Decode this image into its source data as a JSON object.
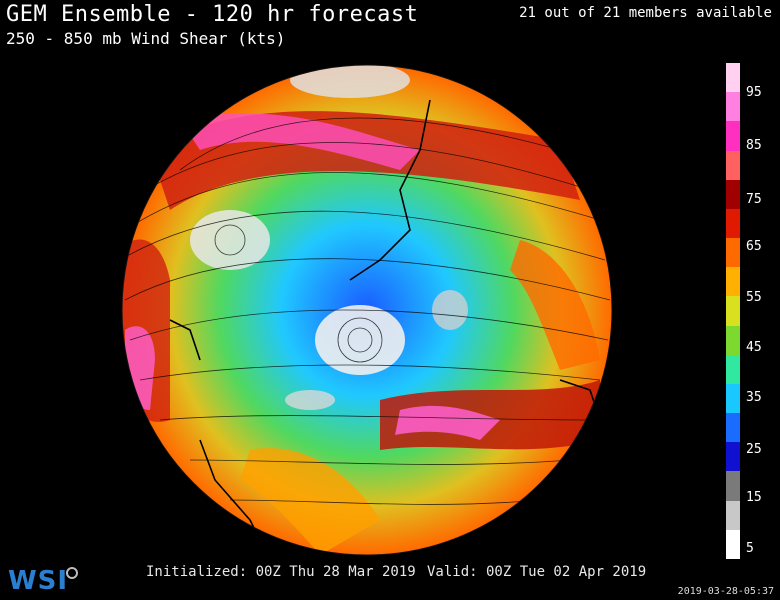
{
  "header": {
    "title": "GEM Ensemble - 120 hr forecast",
    "subtitle": "250 - 850 mb Wind Shear (kts)",
    "members": "21 out of 21 members available"
  },
  "legend": {
    "ticks": [
      "95",
      "85",
      "75",
      "65",
      "55",
      "45",
      "35",
      "25",
      "15",
      "5"
    ],
    "colors": [
      "#ffffff",
      "#c8c8c8",
      "#7a7a7a",
      "#1010d0",
      "#1a6cff",
      "#19c8ff",
      "#30e8a0",
      "#7dd830",
      "#d8e020",
      "#ffb000",
      "#ff6a00",
      "#e01a00",
      "#a00000",
      "#ff6060",
      "#ff30c0",
      "#ff80e0",
      "#ffd0f0"
    ]
  },
  "footer": {
    "initialized": "Initialized: 00Z Thu 28 Mar 2019",
    "valid": "Valid: 00Z Tue 02 Apr 2019",
    "timestamp": "2019-03-28-05:37",
    "logo": "WSI"
  }
}
